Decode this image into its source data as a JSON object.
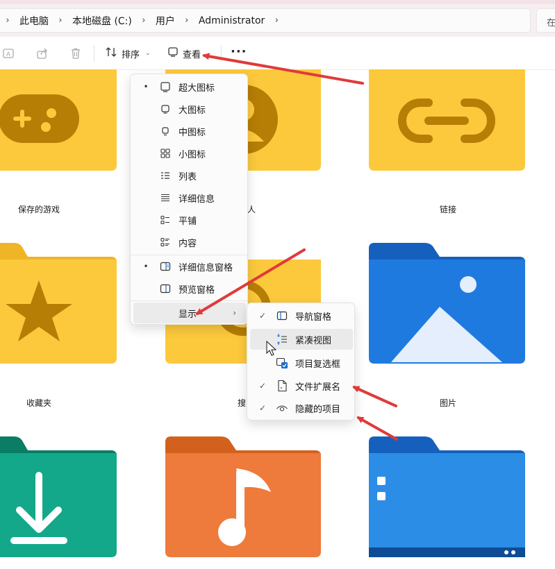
{
  "address_bar": {
    "crumbs": [
      "此电脑",
      "本地磁盘 (C:)",
      "用户",
      "Administrator"
    ],
    "search_placeholder": "在 A"
  },
  "command_bar": {
    "sort_label": "排序",
    "view_label": "查看",
    "more_label": "···"
  },
  "folders": [
    {
      "name": "保存的游戏",
      "icon": "gamepad-icon"
    },
    {
      "name": "人",
      "icon": "contacts-icon"
    },
    {
      "name": "链接",
      "icon": "link-icon"
    },
    {
      "name": "收藏夹",
      "icon": "star-icon"
    },
    {
      "name": "搜",
      "icon": "search-icon"
    },
    {
      "name": "图片",
      "icon": "picture-icon"
    },
    {
      "name": "",
      "icon": "download-icon"
    },
    {
      "name": "",
      "icon": "music-icon"
    },
    {
      "name": "",
      "icon": "desktop-icon"
    }
  ],
  "view_menu": {
    "items": [
      {
        "label": "超大图标",
        "icon": "extra-large-icons-icon",
        "selected": true
      },
      {
        "label": "大图标",
        "icon": "large-icons-icon",
        "selected": false
      },
      {
        "label": "中图标",
        "icon": "medium-icons-icon",
        "selected": false
      },
      {
        "label": "小图标",
        "icon": "small-icons-icon",
        "selected": false
      },
      {
        "label": "列表",
        "icon": "list-icon",
        "selected": false
      },
      {
        "label": "详细信息",
        "icon": "details-icon",
        "selected": false
      },
      {
        "label": "平铺",
        "icon": "tiles-icon",
        "selected": false
      },
      {
        "label": "内容",
        "icon": "content-icon",
        "selected": false
      }
    ],
    "panes": [
      {
        "label": "详细信息窗格",
        "icon": "details-pane-icon",
        "selected": true
      },
      {
        "label": "预览窗格",
        "icon": "preview-pane-icon",
        "selected": false
      }
    ],
    "show_label": "显示"
  },
  "show_submenu": {
    "items": [
      {
        "label": "导航窗格",
        "icon": "navigation-pane-icon",
        "checked": true
      },
      {
        "label": "紧凑视图",
        "icon": "compact-view-icon",
        "checked": false
      },
      {
        "label": "项目复选框",
        "icon": "item-checkbox-icon",
        "checked": false
      },
      {
        "label": "文件扩展名",
        "icon": "file-extension-icon",
        "checked": true
      },
      {
        "label": "隐藏的项目",
        "icon": "hidden-items-icon",
        "checked": true
      }
    ]
  },
  "symbols": {
    "bullet": "•",
    "check": "✓",
    "chevron_right": "›",
    "chevron_down": "⌄"
  },
  "colors": {
    "folder_yellow": "#fcc93c",
    "folder_blue": "#1a6fd1",
    "folder_green": "#13a88a",
    "folder_orange": "#ee7a3c",
    "annotation_red": "#e03a3a"
  }
}
